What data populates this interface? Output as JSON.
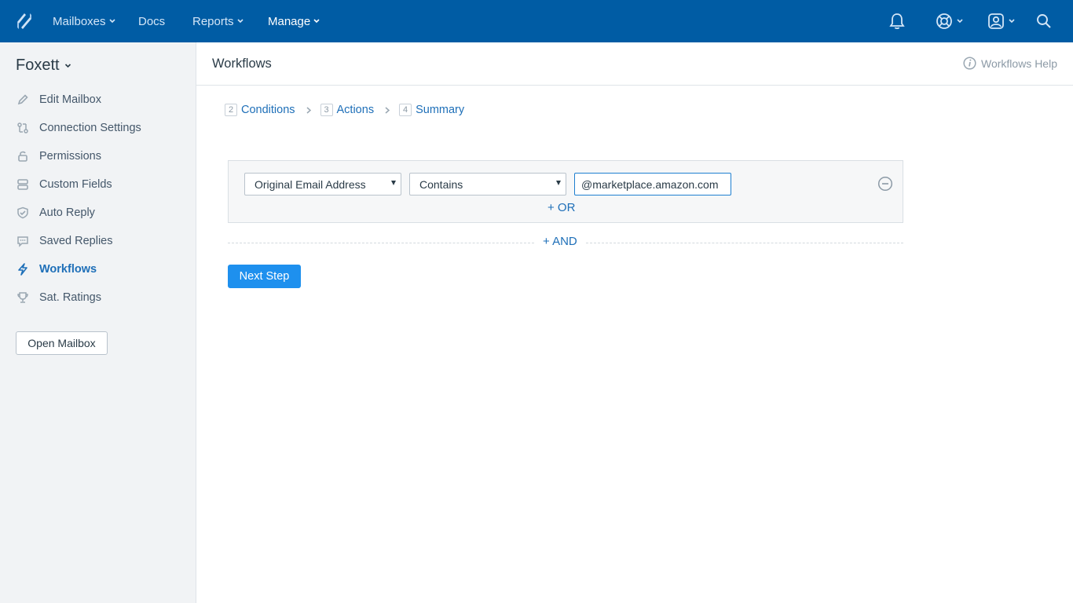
{
  "topbar": {
    "nav": [
      {
        "label": "Mailboxes",
        "has_dropdown": true
      },
      {
        "label": "Docs",
        "has_dropdown": false
      },
      {
        "label": "Reports",
        "has_dropdown": true
      },
      {
        "label": "Manage",
        "has_dropdown": true,
        "active": true
      }
    ],
    "icons": [
      "bell-icon",
      "help-lifebuoy-icon",
      "user-profile-icon",
      "search-icon"
    ],
    "bg_color": "#005ca4"
  },
  "sidebar": {
    "mailbox_name": "Foxett",
    "items": [
      {
        "label": "Edit Mailbox",
        "icon": "pencil-icon"
      },
      {
        "label": "Connection Settings",
        "icon": "connection-icon"
      },
      {
        "label": "Permissions",
        "icon": "lock-icon"
      },
      {
        "label": "Custom Fields",
        "icon": "fields-icon"
      },
      {
        "label": "Auto Reply",
        "icon": "shield-check-icon"
      },
      {
        "label": "Saved Replies",
        "icon": "chat-bubble-icon"
      },
      {
        "label": "Workflows",
        "icon": "lightning-icon",
        "active": true
      },
      {
        "label": "Sat. Ratings",
        "icon": "trophy-icon"
      }
    ],
    "open_mailbox_label": "Open Mailbox"
  },
  "header": {
    "title": "Workflows",
    "help_label": "Workflows Help"
  },
  "steps": [
    {
      "num": "2",
      "label": "Conditions"
    },
    {
      "num": "3",
      "label": "Actions"
    },
    {
      "num": "4",
      "label": "Summary"
    }
  ],
  "condition": {
    "field_select": "Original Email Address",
    "operator_select": "Contains",
    "value": "@marketplace.amazon.com",
    "or_label": "+ OR"
  },
  "and_label": "+ AND",
  "next_step_label": "Next Step",
  "accent_color": "#1e90ee"
}
